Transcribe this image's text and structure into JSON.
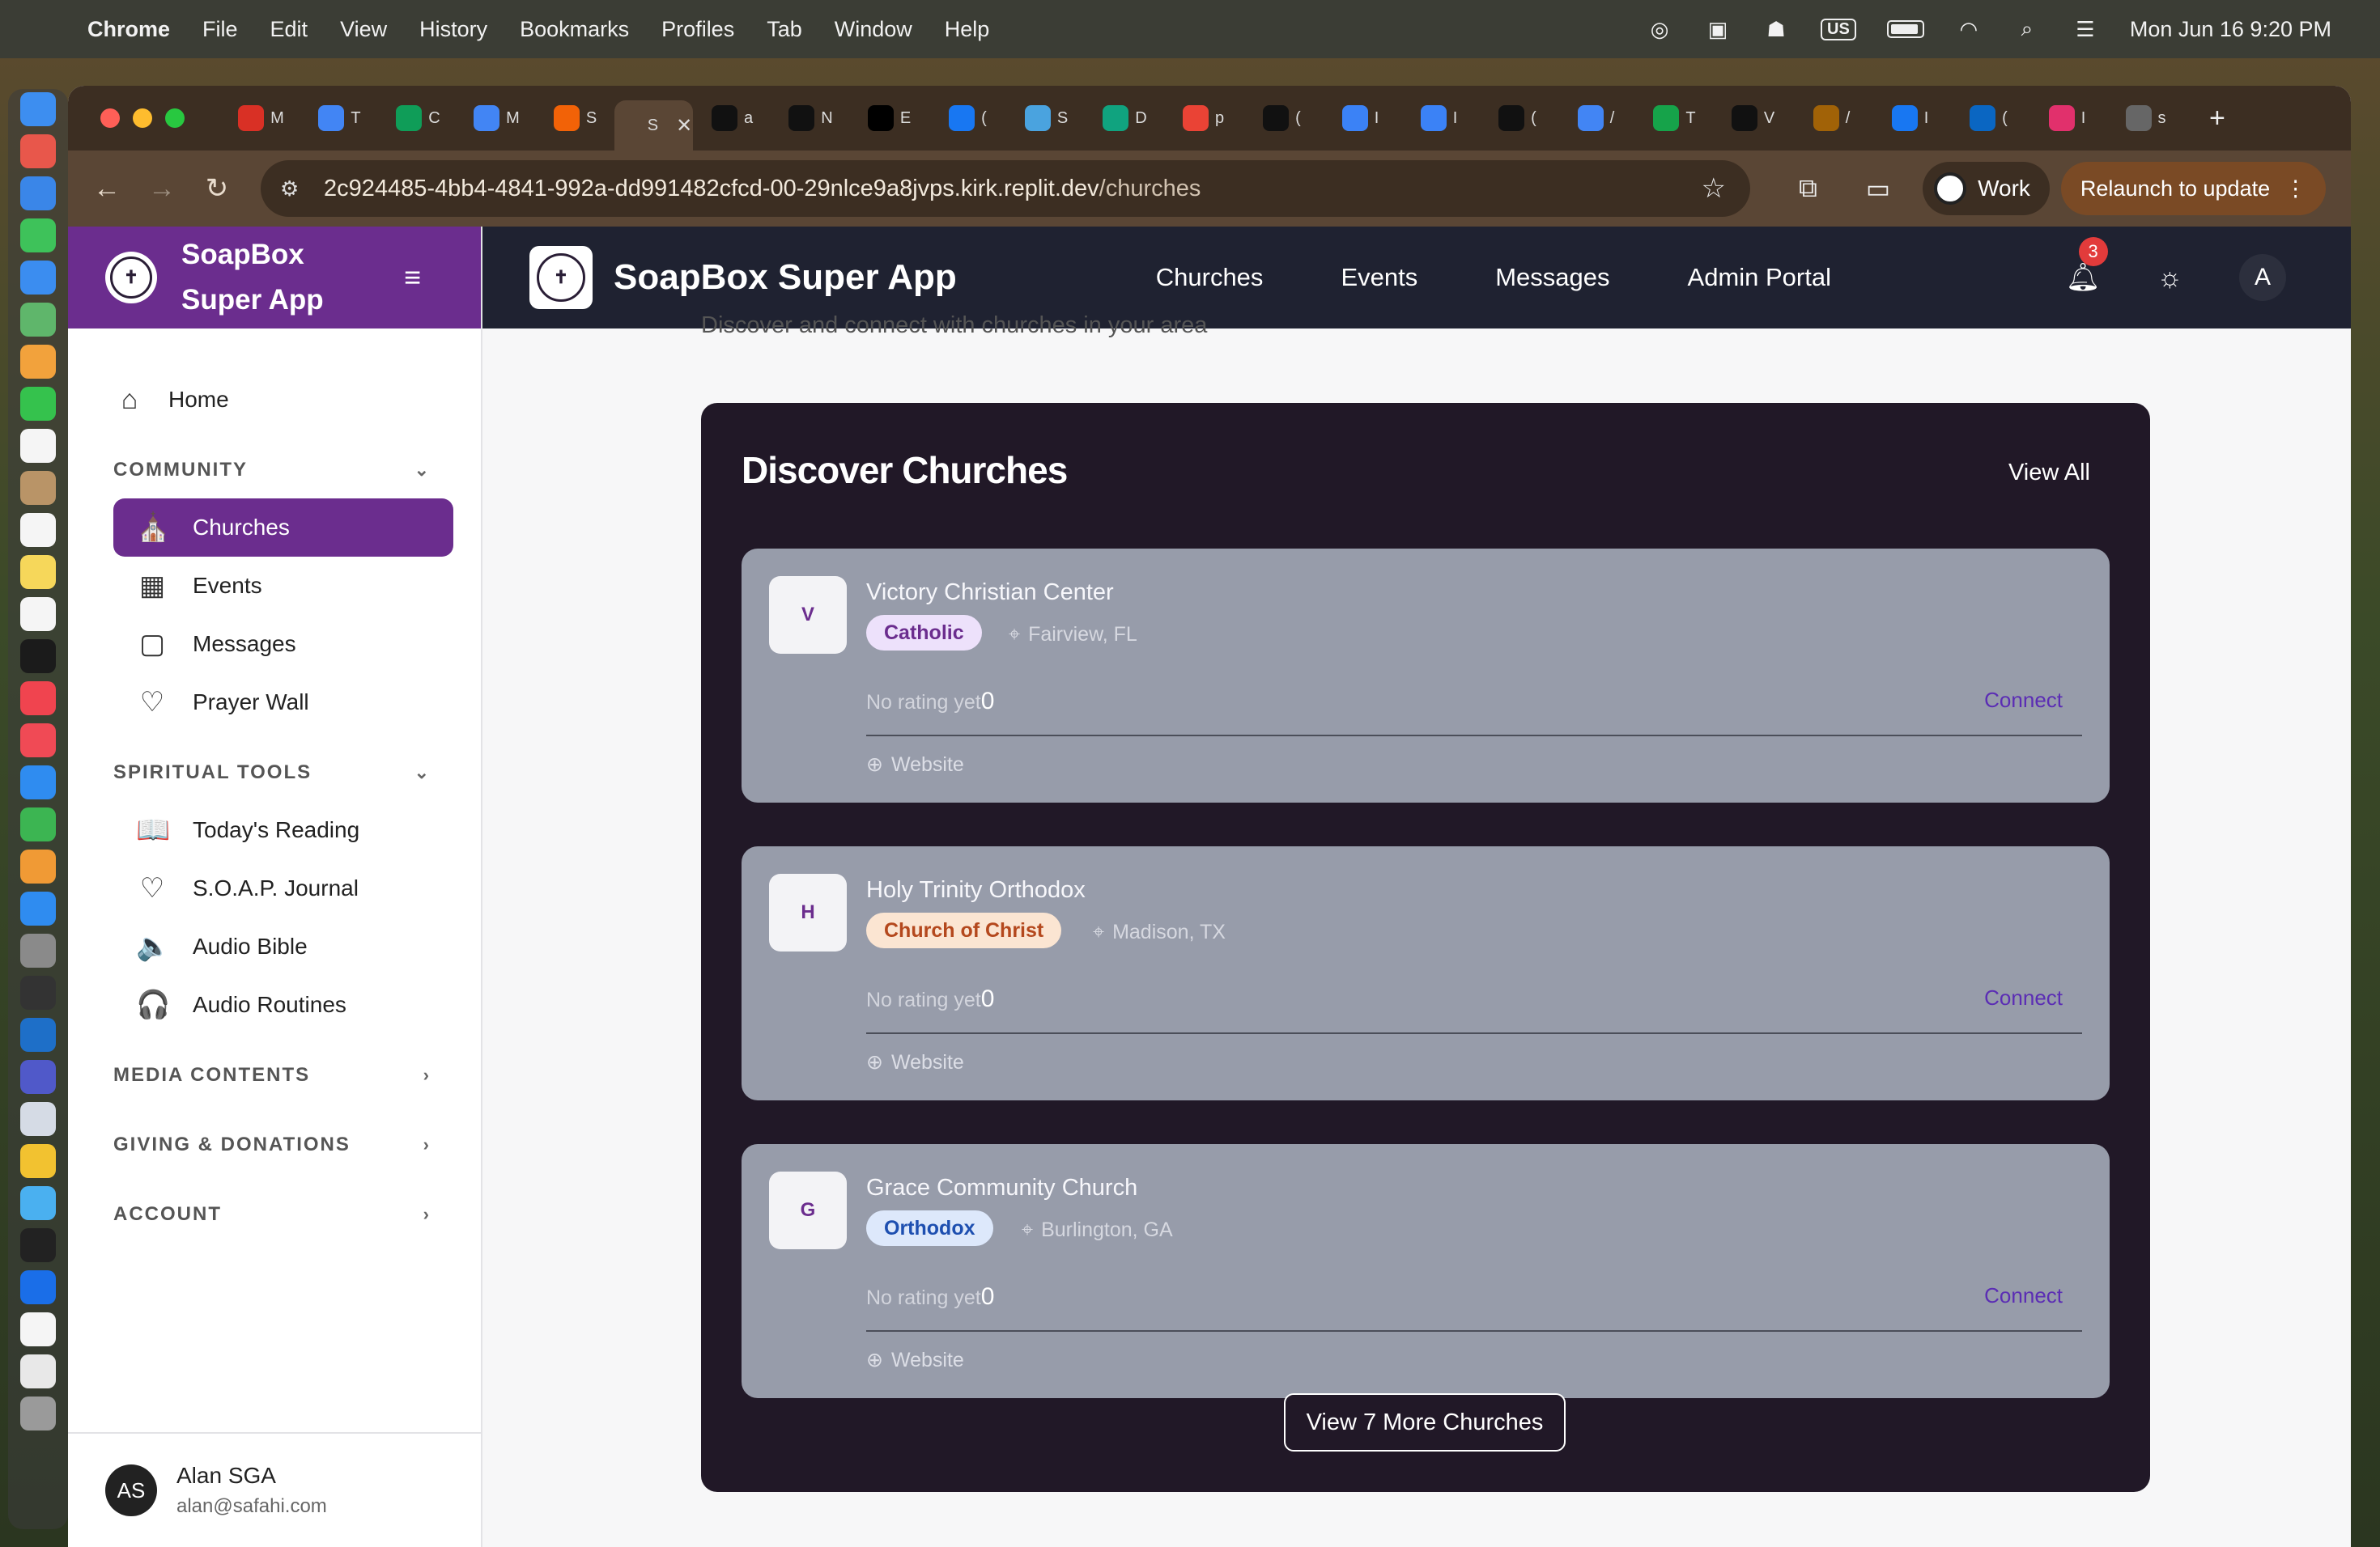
{
  "menubar": {
    "app": "Chrome",
    "items": [
      "File",
      "Edit",
      "View",
      "History",
      "Bookmarks",
      "Profiles",
      "Tab",
      "Window",
      "Help"
    ],
    "input_source": "US",
    "datetime": "Mon Jun 16  9:20 PM"
  },
  "browser": {
    "tabs": [
      {
        "icon": "gmail-icon",
        "label": "M",
        "color": "#d93025"
      },
      {
        "icon": "docs-icon",
        "label": "T",
        "color": "#4285f4"
      },
      {
        "icon": "sheets-icon",
        "label": "C",
        "color": "#0f9d58"
      },
      {
        "icon": "docs-icon",
        "label": "M",
        "color": "#4285f4"
      },
      {
        "icon": "replit-icon",
        "label": "S",
        "color": "#f26207"
      },
      {
        "icon": "soapbox-icon",
        "label": "S",
        "color": "#5a4635",
        "active": true
      },
      {
        "icon": "github-icon",
        "label": "a",
        "color": "#111111"
      },
      {
        "icon": "openai-icon",
        "label": "N",
        "color": "#111111"
      },
      {
        "icon": "x-icon",
        "label": "E",
        "color": "#000000"
      },
      {
        "icon": "facebook-icon",
        "label": "(",
        "color": "#1877f2"
      },
      {
        "icon": "puzzle-icon",
        "label": "S",
        "color": "#4aa3df"
      },
      {
        "icon": "openai-icon",
        "label": "D",
        "color": "#10a37f"
      },
      {
        "icon": "google-icon",
        "label": "p",
        "color": "#ea4335"
      },
      {
        "icon": "openai-icon",
        "label": "(",
        "color": "#111111"
      },
      {
        "icon": "globe-icon",
        "label": "I",
        "color": "#3b82f6"
      },
      {
        "icon": "globe-icon",
        "label": "I",
        "color": "#3b82f6"
      },
      {
        "icon": "github-icon",
        "label": "(",
        "color": "#111111"
      },
      {
        "icon": "g-icon",
        "label": "/",
        "color": "#4285f4"
      },
      {
        "icon": "leaf-icon",
        "label": "T",
        "color": "#16a34a"
      },
      {
        "icon": "bug-icon",
        "label": "V",
        "color": "#111111"
      },
      {
        "icon": "compass-icon",
        "label": "/",
        "color": "#a16207"
      },
      {
        "icon": "facebook-icon",
        "label": "I",
        "color": "#1877f2"
      },
      {
        "icon": "linkedin-icon",
        "label": "(",
        "color": "#0a66c2"
      },
      {
        "icon": "instagram-icon",
        "label": "I",
        "color": "#e1306c"
      },
      {
        "icon": "chrome-icon",
        "label": "s",
        "color": "#666666"
      }
    ],
    "close_label": "✕",
    "new_tab": "+",
    "url_host": "2c924485-4bb4-4841-992a-dd991482cfcd-00-29nlce9a8jvps.kirk.replit.dev",
    "url_path": "/churches",
    "profile": "Work",
    "relaunch": "Relaunch to update"
  },
  "sidebar": {
    "title": "SoapBox Super App",
    "home": "Home",
    "sections": {
      "community": "COMMUNITY",
      "spiritual": "SPIRITUAL TOOLS",
      "media": "MEDIA CONTENTS",
      "giving": "GIVING & DONATIONS",
      "account": "ACCOUNT"
    },
    "community_items": [
      "Churches",
      "Events",
      "Messages",
      "Prayer Wall"
    ],
    "spiritual_items": [
      "Today's Reading",
      "S.O.A.P. Journal",
      "Audio Bible",
      "Audio Routines"
    ],
    "user": {
      "initials": "AS",
      "name": "Alan SGA",
      "email": "alan@safahi.com"
    }
  },
  "header": {
    "title": "SoapBox Super App",
    "nav": [
      "Churches",
      "Events",
      "Messages",
      "Admin Portal"
    ],
    "notifications": "3",
    "avatar": "A"
  },
  "main": {
    "subtitle": "Discover and connect with churches in your area",
    "panel_title": "Discover Churches",
    "view_all": "View All",
    "more_button": "View 7 More Churches",
    "churches": [
      {
        "initial": "V",
        "name": "Victory Christian Center",
        "denomination": "Catholic",
        "tag_bg": "#ede1fb",
        "tag_fg": "#6b2d8e",
        "location": "Fairview, FL",
        "rating": "No rating yet",
        "count": "0",
        "connect": "Connect",
        "website": "Website"
      },
      {
        "initial": "H",
        "name": "Holy Trinity Orthodox",
        "denomination": "Church of Christ",
        "tag_bg": "#fbe5d2",
        "tag_fg": "#b4481d",
        "location": "Madison, TX",
        "rating": "No rating yet",
        "count": "0",
        "connect": "Connect",
        "website": "Website"
      },
      {
        "initial": "G",
        "name": "Grace Community Church",
        "denomination": "Orthodox",
        "tag_bg": "#dde8fb",
        "tag_fg": "#1e4fb0",
        "location": "Burlington, GA",
        "rating": "No rating yet",
        "count": "0",
        "connect": "Connect",
        "website": "Website"
      }
    ]
  },
  "colors": {
    "brand_purple": "#6b2d8e",
    "header_dark": "#1f2231",
    "panel_dark": "#211827",
    "card_gray": "#979caa"
  }
}
